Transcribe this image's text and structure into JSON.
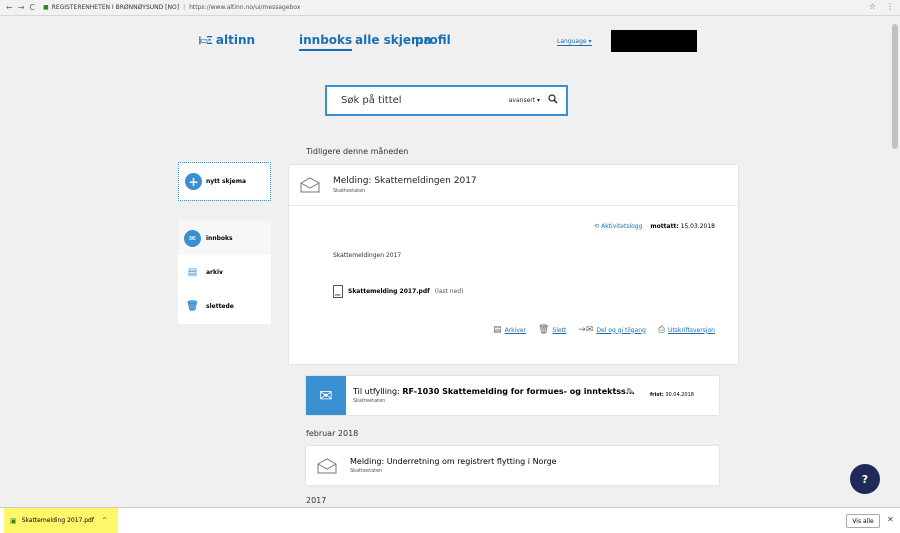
{
  "browser": {
    "org": "REGISTERENHETEN I BRØNNØYSUND [NO]",
    "url": "https://www.altinn.no/ui/messagebox",
    "back_glyph": "←",
    "forward_glyph": "→",
    "reload_glyph": "C",
    "star_glyph": "☆",
    "menu_glyph": "⋮"
  },
  "nav": {
    "logo_text": "altinn",
    "tabs": [
      {
        "label": "innboks",
        "active": true
      },
      {
        "label": "alle skjema",
        "active": false
      },
      {
        "label": "profil",
        "active": false
      }
    ],
    "language": "Language ▾"
  },
  "search": {
    "placeholder": "Søk på tittel",
    "advanced": "avansert ▾"
  },
  "sidebar": {
    "new_label": "nytt skjema",
    "items": [
      {
        "label": "innboks",
        "active": true
      },
      {
        "label": "arkiv",
        "active": false
      },
      {
        "label": "slettede",
        "active": false
      }
    ]
  },
  "sections": {
    "earlier": "Tidligere denne måneden",
    "feb": "februar 2018",
    "year": "2017"
  },
  "expanded_message": {
    "title": "Melding: Skattemeldingen 2017",
    "sender": "Skatteetaten",
    "activity_log": "Aktivitetslogg",
    "received_label": "mottatt:",
    "received_date": "15.03.2018",
    "body": "Skattemeldingen 2017",
    "attachment_name": "Skattemelding 2017.pdf",
    "attachment_action": "(last ned)",
    "actions": [
      {
        "label": "Arkiver",
        "icon": "archive-icon"
      },
      {
        "label": "Slett",
        "icon": "trash-icon"
      },
      {
        "label": "Del og gi tilgang",
        "icon": "share-icon"
      },
      {
        "label": "Utskriftsversjon",
        "icon": "print-icon"
      }
    ]
  },
  "task": {
    "prefix": "Til utfylling:",
    "title": "RF-1030 Skattemelding for formues- og inntektss...",
    "sender": "Skatteetaten",
    "due_label": "frist:",
    "due_date": "30.04.2018"
  },
  "feb_message": {
    "title": "Melding: Underretning om registrert flytting i Norge",
    "sender": "Skatteetaten"
  },
  "help_label": "?",
  "download_bar": {
    "file": "Skattemelding 2017.pdf",
    "show_all": "Vis alle",
    "close_glyph": "✕"
  },
  "colors": {
    "accent": "#3a8fd1",
    "link": "#1a6fb4",
    "help": "#1f2a56",
    "highlight": "#fff76a"
  }
}
